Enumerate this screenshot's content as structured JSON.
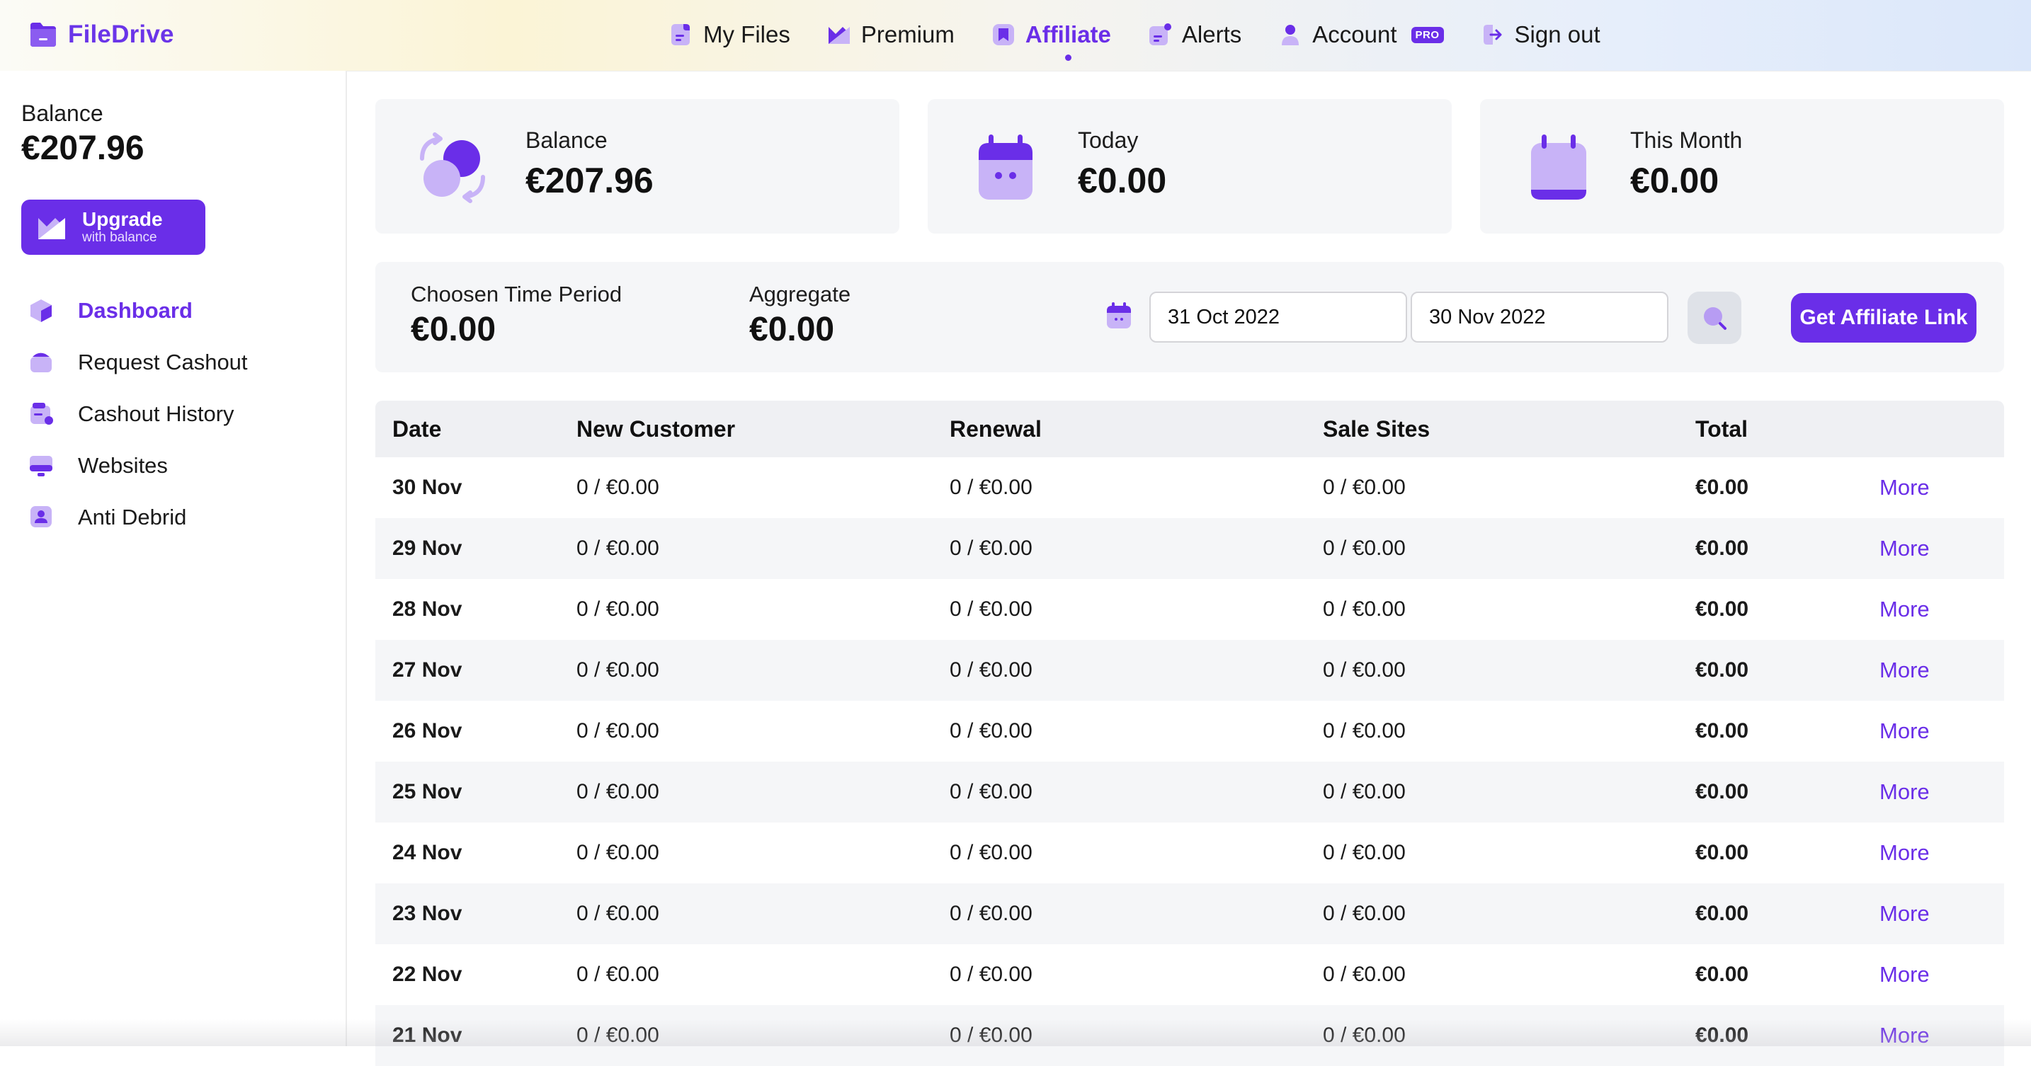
{
  "app": {
    "name": "FileDrive",
    "accent": "#6a2ee8"
  },
  "nav": {
    "items": [
      {
        "label": "My Files",
        "icon": "file-icon"
      },
      {
        "label": "Premium",
        "icon": "premium-icon"
      },
      {
        "label": "Affiliate",
        "icon": "affiliate-icon",
        "active": true
      },
      {
        "label": "Alerts",
        "icon": "bell-icon"
      },
      {
        "label": "Account",
        "icon": "user-icon",
        "badge": "PRO"
      },
      {
        "label": "Sign out",
        "icon": "sign-out-icon"
      }
    ]
  },
  "sidebar": {
    "balance_label": "Balance",
    "balance_value": "€207.96",
    "upgrade_title": "Upgrade",
    "upgrade_subtitle": "with balance",
    "items": [
      {
        "label": "Dashboard",
        "icon": "cube-icon",
        "active": true
      },
      {
        "label": "Request Cashout",
        "icon": "wallet-icon"
      },
      {
        "label": "Cashout History",
        "icon": "history-icon"
      },
      {
        "label": "Websites",
        "icon": "monitor-icon"
      },
      {
        "label": "Anti Debrid",
        "icon": "shield-user-icon"
      }
    ]
  },
  "cards": [
    {
      "label": "Balance",
      "value": "€207.96",
      "icon": "coins-exchange-icon"
    },
    {
      "label": "Today",
      "value": "€0.00",
      "icon": "calendar-face-icon"
    },
    {
      "label": "This Month",
      "value": "€0.00",
      "icon": "calendar-icon"
    }
  ],
  "filter": {
    "period_label": "Choosen Time Period",
    "period_value": "€0.00",
    "aggregate_label": "Aggregate",
    "aggregate_value": "€0.00",
    "date_from": "31 Oct 2022",
    "date_to": "30 Nov 2022",
    "affiliate_button": "Get Affiliate Link"
  },
  "table": {
    "headers": [
      "Date",
      "New Customer",
      "Renewal",
      "Sale Sites",
      "Total"
    ],
    "more_label": "More",
    "rows": [
      {
        "date": "30 Nov",
        "new": "0 / €0.00",
        "renewal": "0 / €0.00",
        "sale": "0 / €0.00",
        "total": "€0.00"
      },
      {
        "date": "29 Nov",
        "new": "0 / €0.00",
        "renewal": "0 / €0.00",
        "sale": "0 / €0.00",
        "total": "€0.00"
      },
      {
        "date": "28 Nov",
        "new": "0 / €0.00",
        "renewal": "0 / €0.00",
        "sale": "0 / €0.00",
        "total": "€0.00"
      },
      {
        "date": "27 Nov",
        "new": "0 / €0.00",
        "renewal": "0 / €0.00",
        "sale": "0 / €0.00",
        "total": "€0.00"
      },
      {
        "date": "26 Nov",
        "new": "0 / €0.00",
        "renewal": "0 / €0.00",
        "sale": "0 / €0.00",
        "total": "€0.00"
      },
      {
        "date": "25 Nov",
        "new": "0 / €0.00",
        "renewal": "0 / €0.00",
        "sale": "0 / €0.00",
        "total": "€0.00"
      },
      {
        "date": "24 Nov",
        "new": "0 / €0.00",
        "renewal": "0 / €0.00",
        "sale": "0 / €0.00",
        "total": "€0.00"
      },
      {
        "date": "23 Nov",
        "new": "0 / €0.00",
        "renewal": "0 / €0.00",
        "sale": "0 / €0.00",
        "total": "€0.00"
      },
      {
        "date": "22 Nov",
        "new": "0 / €0.00",
        "renewal": "0 / €0.00",
        "sale": "0 / €0.00",
        "total": "€0.00"
      },
      {
        "date": "21 Nov",
        "new": "0 / €0.00",
        "renewal": "0 / €0.00",
        "sale": "0 / €0.00",
        "total": "€0.00"
      }
    ]
  }
}
